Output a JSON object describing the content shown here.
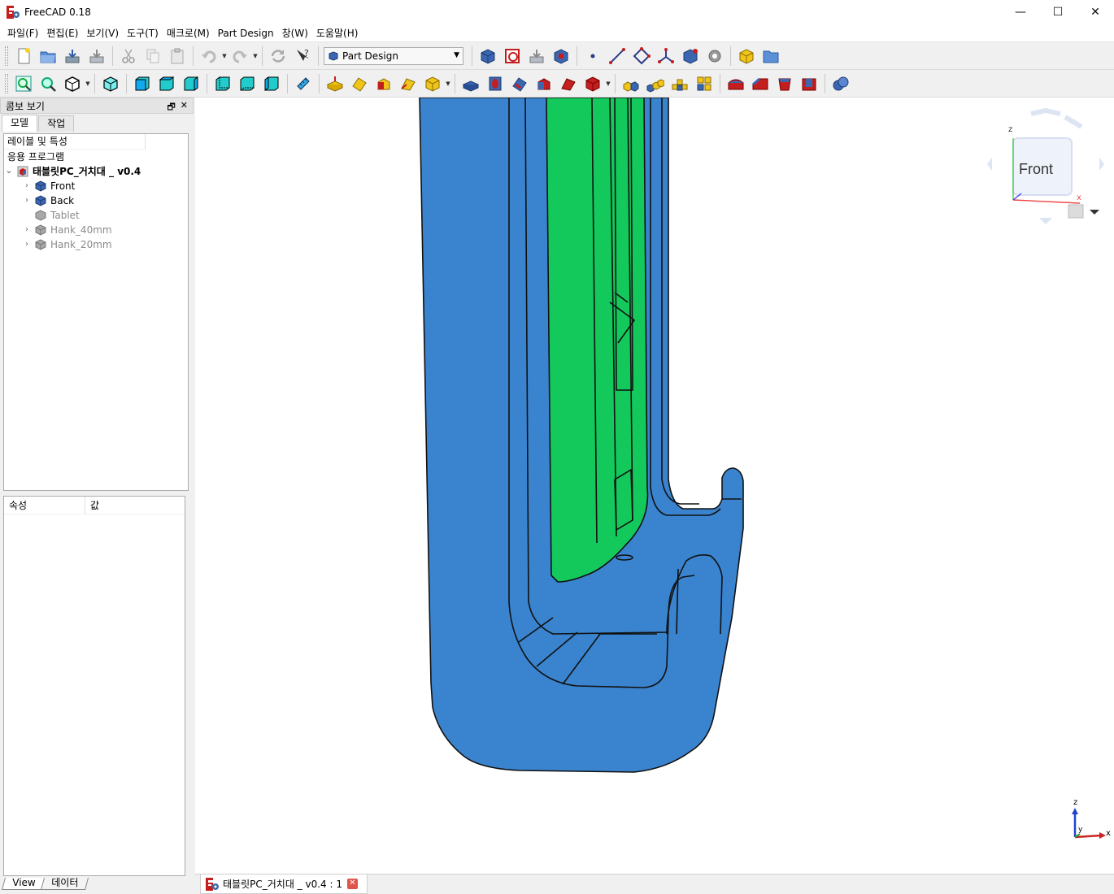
{
  "window": {
    "title": "FreeCAD 0.18",
    "minimize": "—",
    "maximize": "☐",
    "close": "✕"
  },
  "menu": [
    "파일(F)",
    "편집(E)",
    "보기(V)",
    "도구(T)",
    "매크로(M)",
    "Part Design",
    "창(W)",
    "도움말(H)"
  ],
  "workbench": {
    "selected": "Part Design"
  },
  "combo": {
    "title": "콤보 보기",
    "tabs": {
      "model": "모델",
      "task": "작업"
    },
    "tree_header": "레이블 및 특성",
    "app_label": "응용 프로그램",
    "document": "태블릿PC_거치대 _ v0.4",
    "items": [
      {
        "label": "Front",
        "state": "visible"
      },
      {
        "label": "Back",
        "state": "visible"
      },
      {
        "label": "Tablet",
        "state": "hidden"
      },
      {
        "label": "Hank_40mm",
        "state": "hidden"
      },
      {
        "label": "Hank_20mm",
        "state": "hidden"
      }
    ],
    "props": {
      "col_property": "속성",
      "col_value": "값"
    },
    "bottom_tabs": {
      "view": "View",
      "data": "데이터"
    }
  },
  "navcube": {
    "face": "Front",
    "axis_z": "z",
    "axis_x": "x"
  },
  "axis_cross": {
    "z": "z",
    "y": "y",
    "x": "x"
  },
  "doc_tab": {
    "label": "태블릿PC_거치대 _ v0.4 : 1",
    "close": "✕"
  },
  "colors": {
    "body_blue": "#3a84cf",
    "tablet_green": "#13c95c",
    "edge": "#111111"
  }
}
